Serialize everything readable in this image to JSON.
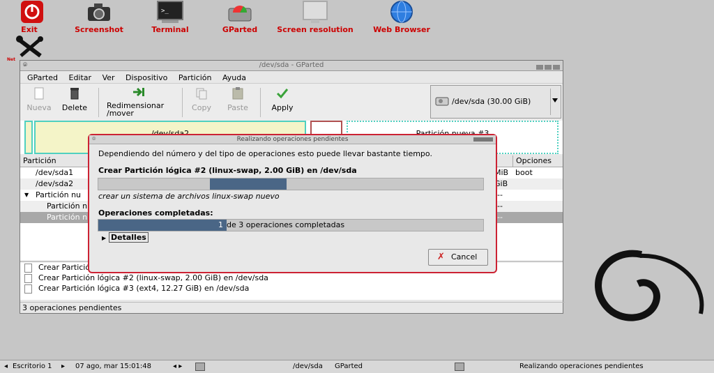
{
  "desktop": {
    "icons": [
      {
        "name": "exit",
        "label": "Exit"
      },
      {
        "name": "screenshot",
        "label": "Screenshot"
      },
      {
        "name": "terminal",
        "label": "Terminal"
      },
      {
        "name": "gparted",
        "label": "GParted"
      },
      {
        "name": "screen-resolution",
        "label": "Screen resolution"
      },
      {
        "name": "web-browser",
        "label": "Web Browser"
      },
      {
        "name": "network",
        "label": "Net"
      }
    ]
  },
  "window": {
    "title": "/dev/sda - GParted",
    "menu": [
      "GParted",
      "Editar",
      "Ver",
      "Dispositivo",
      "Partición",
      "Ayuda"
    ],
    "toolbar": {
      "new": "Nueva",
      "delete": "Delete",
      "resize": "Redimensionar\n/mover",
      "copy": "Copy",
      "paste": "Paste",
      "apply": "Apply"
    },
    "device": "/dev/sda  (30.00 GiB)",
    "graph": {
      "sda2": "/dev/sda2",
      "new_partition": "Partición nueva #3"
    },
    "table": {
      "header_partition": "Partición",
      "header_options": "Opciones",
      "rows": [
        {
          "name": "/dev/sda1",
          "right": "MiB",
          "opts": "boot"
        },
        {
          "name": "/dev/sda2",
          "right": "GiB",
          "opts": ""
        },
        {
          "name": "Partición nu",
          "right": "---",
          "opts": ""
        },
        {
          "name": "Partición n",
          "right": "---",
          "opts": ""
        },
        {
          "name": "Partición n",
          "right": "---",
          "opts": ""
        }
      ]
    },
    "operations": [
      "Crear Partición",
      "Crear Partición lógica #2 (linux-swap, 2.00 GiB) en /dev/sda",
      "Crear Partición lógica #3 (ext4, 12.27 GiB) en /dev/sda"
    ],
    "status": "3 operaciones pendientes"
  },
  "dialog": {
    "title": "Realizando operaciones pendientes",
    "intro": "Dependiendo del número y del tipo de operaciones esto puede llevar bastante tiempo.",
    "current_op": "Crear Partición lógica #2 (linux-swap, 2.00 GiB) en /dev/sda",
    "sub_op": "crear un sistema de archivos linux-swap nuevo",
    "completed_label": "Operaciones completadas:",
    "progress_text_num": "1",
    "progress_text": "de 3 operaciones completadas",
    "details": "Detalles",
    "cancel": "Cancel",
    "sub_progress": 0.2,
    "overall_progress": 0.333
  },
  "taskbar": {
    "desktop": "Escritorio 1",
    "datetime": "07 ago, mar 15:01:48",
    "task1": "/dev/sda",
    "task1b": "GParted",
    "task2": "Realizando operaciones pendientes"
  }
}
